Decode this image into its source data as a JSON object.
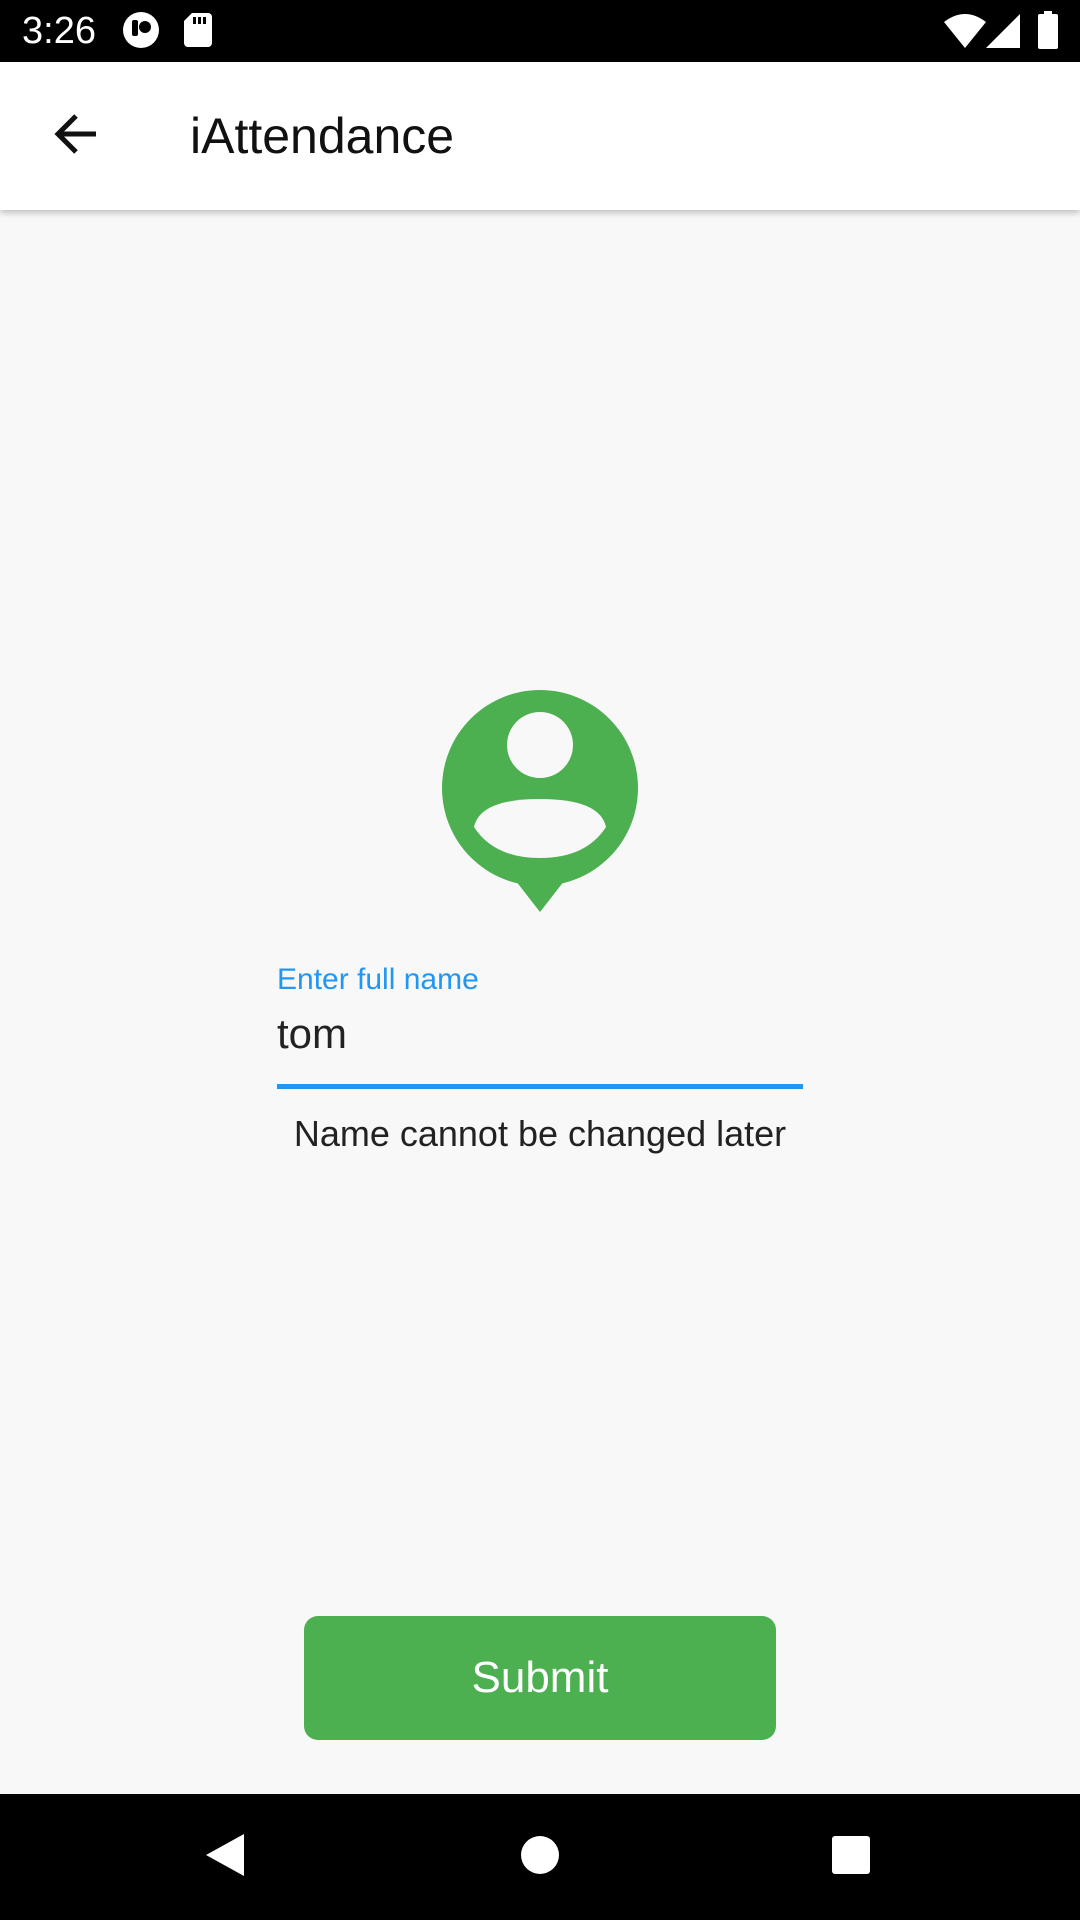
{
  "status_bar": {
    "time": "3:26",
    "icons": [
      "notification-app-icon",
      "sd-card-icon",
      "wifi-icon",
      "cellular-signal-icon",
      "battery-icon"
    ]
  },
  "app_bar": {
    "title": "iAttendance",
    "back_icon": "arrow-back-icon"
  },
  "avatar": {
    "icon": "person-pin-icon",
    "color": "#4caf50"
  },
  "name_field": {
    "label": "Enter full name",
    "value": "tom",
    "accent_color": "#2196f3"
  },
  "helper_text": "Name cannot be changed later",
  "submit": {
    "label": "Submit",
    "color": "#4caf50"
  },
  "nav_bar": {
    "icons": [
      "back-triangle-icon",
      "home-circle-icon",
      "recents-square-icon"
    ]
  }
}
